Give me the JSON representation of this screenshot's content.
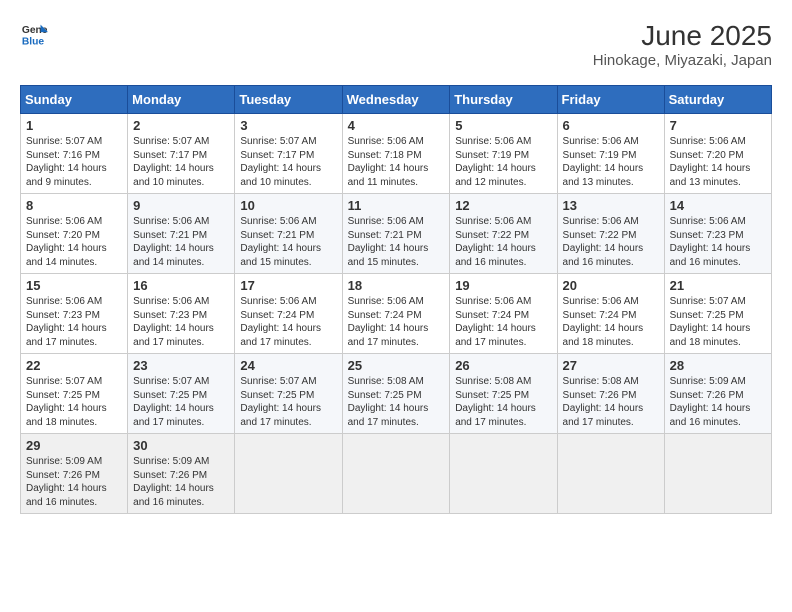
{
  "logo": {
    "line1": "General",
    "line2": "Blue"
  },
  "title": "June 2025",
  "subtitle": "Hinokage, Miyazaki, Japan",
  "weekdays": [
    "Sunday",
    "Monday",
    "Tuesday",
    "Wednesday",
    "Thursday",
    "Friday",
    "Saturday"
  ],
  "weeks": [
    [
      {
        "day": "1",
        "sunrise": "5:07 AM",
        "sunset": "7:16 PM",
        "daylight": "14 hours and 9 minutes."
      },
      {
        "day": "2",
        "sunrise": "5:07 AM",
        "sunset": "7:17 PM",
        "daylight": "14 hours and 10 minutes."
      },
      {
        "day": "3",
        "sunrise": "5:07 AM",
        "sunset": "7:17 PM",
        "daylight": "14 hours and 10 minutes."
      },
      {
        "day": "4",
        "sunrise": "5:06 AM",
        "sunset": "7:18 PM",
        "daylight": "14 hours and 11 minutes."
      },
      {
        "day": "5",
        "sunrise": "5:06 AM",
        "sunset": "7:19 PM",
        "daylight": "14 hours and 12 minutes."
      },
      {
        "day": "6",
        "sunrise": "5:06 AM",
        "sunset": "7:19 PM",
        "daylight": "14 hours and 13 minutes."
      },
      {
        "day": "7",
        "sunrise": "5:06 AM",
        "sunset": "7:20 PM",
        "daylight": "14 hours and 13 minutes."
      }
    ],
    [
      {
        "day": "8",
        "sunrise": "5:06 AM",
        "sunset": "7:20 PM",
        "daylight": "14 hours and 14 minutes."
      },
      {
        "day": "9",
        "sunrise": "5:06 AM",
        "sunset": "7:21 PM",
        "daylight": "14 hours and 14 minutes."
      },
      {
        "day": "10",
        "sunrise": "5:06 AM",
        "sunset": "7:21 PM",
        "daylight": "14 hours and 15 minutes."
      },
      {
        "day": "11",
        "sunrise": "5:06 AM",
        "sunset": "7:21 PM",
        "daylight": "14 hours and 15 minutes."
      },
      {
        "day": "12",
        "sunrise": "5:06 AM",
        "sunset": "7:22 PM",
        "daylight": "14 hours and 16 minutes."
      },
      {
        "day": "13",
        "sunrise": "5:06 AM",
        "sunset": "7:22 PM",
        "daylight": "14 hours and 16 minutes."
      },
      {
        "day": "14",
        "sunrise": "5:06 AM",
        "sunset": "7:23 PM",
        "daylight": "14 hours and 16 minutes."
      }
    ],
    [
      {
        "day": "15",
        "sunrise": "5:06 AM",
        "sunset": "7:23 PM",
        "daylight": "14 hours and 17 minutes."
      },
      {
        "day": "16",
        "sunrise": "5:06 AM",
        "sunset": "7:23 PM",
        "daylight": "14 hours and 17 minutes."
      },
      {
        "day": "17",
        "sunrise": "5:06 AM",
        "sunset": "7:24 PM",
        "daylight": "14 hours and 17 minutes."
      },
      {
        "day": "18",
        "sunrise": "5:06 AM",
        "sunset": "7:24 PM",
        "daylight": "14 hours and 17 minutes."
      },
      {
        "day": "19",
        "sunrise": "5:06 AM",
        "sunset": "7:24 PM",
        "daylight": "14 hours and 17 minutes."
      },
      {
        "day": "20",
        "sunrise": "5:06 AM",
        "sunset": "7:24 PM",
        "daylight": "14 hours and 18 minutes."
      },
      {
        "day": "21",
        "sunrise": "5:07 AM",
        "sunset": "7:25 PM",
        "daylight": "14 hours and 18 minutes."
      }
    ],
    [
      {
        "day": "22",
        "sunrise": "5:07 AM",
        "sunset": "7:25 PM",
        "daylight": "14 hours and 18 minutes."
      },
      {
        "day": "23",
        "sunrise": "5:07 AM",
        "sunset": "7:25 PM",
        "daylight": "14 hours and 17 minutes."
      },
      {
        "day": "24",
        "sunrise": "5:07 AM",
        "sunset": "7:25 PM",
        "daylight": "14 hours and 17 minutes."
      },
      {
        "day": "25",
        "sunrise": "5:08 AM",
        "sunset": "7:25 PM",
        "daylight": "14 hours and 17 minutes."
      },
      {
        "day": "26",
        "sunrise": "5:08 AM",
        "sunset": "7:25 PM",
        "daylight": "14 hours and 17 minutes."
      },
      {
        "day": "27",
        "sunrise": "5:08 AM",
        "sunset": "7:26 PM",
        "daylight": "14 hours and 17 minutes."
      },
      {
        "day": "28",
        "sunrise": "5:09 AM",
        "sunset": "7:26 PM",
        "daylight": "14 hours and 16 minutes."
      }
    ],
    [
      {
        "day": "29",
        "sunrise": "5:09 AM",
        "sunset": "7:26 PM",
        "daylight": "14 hours and 16 minutes."
      },
      {
        "day": "30",
        "sunrise": "5:09 AM",
        "sunset": "7:26 PM",
        "daylight": "14 hours and 16 minutes."
      },
      null,
      null,
      null,
      null,
      null
    ]
  ],
  "labels": {
    "sunrise": "Sunrise:",
    "sunset": "Sunset:",
    "daylight": "Daylight:"
  }
}
